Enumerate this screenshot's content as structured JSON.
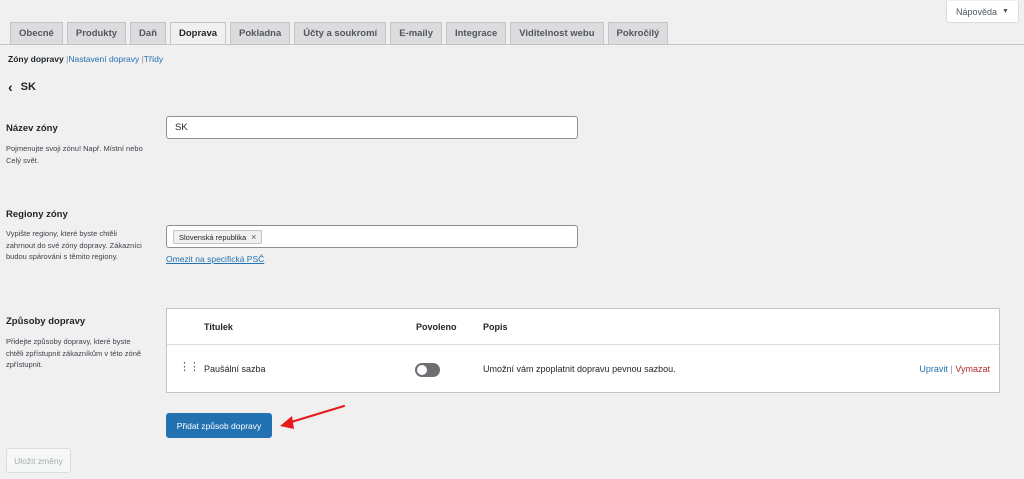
{
  "help": {
    "label": "Nápověda",
    "caret": "▼"
  },
  "tabs": [
    {
      "label": "Obecné"
    },
    {
      "label": "Produkty"
    },
    {
      "label": "Daň"
    },
    {
      "label": "Doprava",
      "active": true
    },
    {
      "label": "Pokladna"
    },
    {
      "label": "Účty a soukromí"
    },
    {
      "label": "E-maily"
    },
    {
      "label": "Integrace"
    },
    {
      "label": "Viditelnost webu"
    },
    {
      "label": "Pokročilý"
    }
  ],
  "subnav": {
    "current": "Zóny dopravy",
    "sep": "|",
    "items": [
      "Nastavení dopravy",
      "Třídy"
    ]
  },
  "zone": {
    "back": "‹",
    "title": "SK"
  },
  "zone_name": {
    "label": "Název zóny",
    "description": "Pojmenujte svoji zónu! Např. Místní nebo Celý svět.",
    "value": "SK"
  },
  "zone_regions": {
    "label": "Regiony zóny",
    "description": "Vypište regiony, které byste chtěli zahrnout do své zóny dopravy. Zákazníci budou spárováni s těmito regiony.",
    "chip": "Slovenská republika",
    "chip_remove": "×",
    "limit_link": "Omezit na specifická PSČ"
  },
  "shipping_methods": {
    "label": "Způsoby dopravy",
    "description": "Přidejte způsoby dopravy, které byste chtěli zpřístupnit zákazníkům v této zóně zpřístupnit.",
    "columns": {
      "title": "Titulek",
      "enabled": "Povoleno",
      "description": "Popis"
    },
    "rows": [
      {
        "drag": "⋮⋮",
        "title": "Paušální sazba",
        "enabled": false,
        "description": "Umožní vám zpoplatnit dopravu pevnou sazbou.",
        "edit": "Upravit",
        "separator": "|",
        "delete": "Vymazat"
      }
    ]
  },
  "add_method_button": "Přidat způsob dopravy",
  "save_button": "Uložit změny",
  "colors": {
    "primary": "#2271b1",
    "danger": "#b32d2e",
    "annotation_arrow": "#e51b1b"
  }
}
